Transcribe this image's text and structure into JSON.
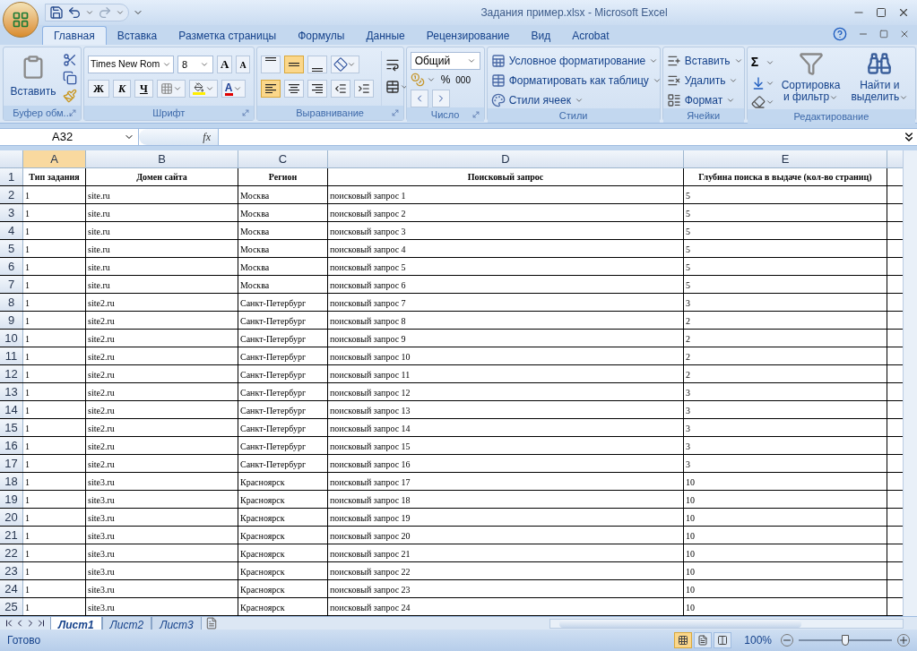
{
  "title_bar": {
    "title": "Задания пример.xlsx - Microsoft Excel"
  },
  "tabs": [
    {
      "label": "Главная",
      "selected": true
    },
    {
      "label": "Вставка",
      "selected": false
    },
    {
      "label": "Разметка страницы",
      "selected": false
    },
    {
      "label": "Формулы",
      "selected": false
    },
    {
      "label": "Данные",
      "selected": false
    },
    {
      "label": "Рецензирование",
      "selected": false
    },
    {
      "label": "Вид",
      "selected": false
    },
    {
      "label": "Acrobat",
      "selected": false
    }
  ],
  "ribbon": {
    "clipboard": {
      "label": "Буфер обм...",
      "paste": "Вставить"
    },
    "font": {
      "label": "Шрифт",
      "font_name": "Times New Rom",
      "font_size": "8",
      "grow": "A",
      "shrink": "A",
      "bold": "Ж",
      "italic": "К",
      "underline": "Ч",
      "font_color": "A"
    },
    "alignment": {
      "label": "Выравнивание",
      "vertical": [
        {
          "selected": false
        },
        {
          "selected": true
        },
        {
          "selected": false
        }
      ],
      "horizontal": [
        {
          "selected": true
        },
        {
          "selected": false
        },
        {
          "selected": false
        }
      ]
    },
    "number": {
      "label": "Число",
      "format": "Общий",
      "percent": "%",
      "thousands": "000"
    },
    "styles": {
      "label": "Стили",
      "items": [
        "Условное форматирование",
        "Форматировать как таблицу",
        "Стили ячеек"
      ]
    },
    "cells": {
      "label": "Ячейки",
      "items": [
        "Вставить",
        "Удалить",
        "Формат"
      ]
    },
    "editing": {
      "label": "Редактирование",
      "sigma": "Σ",
      "sort": [
        "Сортировка",
        "и фильтр"
      ],
      "find": [
        "Найти и",
        "выделить"
      ]
    }
  },
  "formula_bar": {
    "name_box": "A32",
    "fx": "fx"
  },
  "sheet": {
    "columns": [
      {
        "label": "A",
        "selected": true
      },
      {
        "label": "B",
        "selected": false
      },
      {
        "label": "C",
        "selected": false
      },
      {
        "label": "D",
        "selected": false
      },
      {
        "label": "E",
        "selected": false
      }
    ],
    "rows": [
      {
        "number": "1",
        "kind": "header",
        "cells": [
          "Тип задания",
          "Домен сайта",
          "Регион",
          "Поисковый запрос",
          "Глубина поиска в выдаче (кол-во страниц)"
        ]
      },
      {
        "number": "2",
        "kind": "data",
        "cells": [
          "1",
          "site.ru",
          "Москва",
          "поисковый запрос 1",
          "5"
        ]
      },
      {
        "number": "3",
        "kind": "data",
        "cells": [
          "1",
          "site.ru",
          "Москва",
          "поисковый запрос 2",
          "5"
        ]
      },
      {
        "number": "4",
        "kind": "data",
        "cells": [
          "1",
          "site.ru",
          "Москва",
          "поисковый запрос 3",
          "5"
        ]
      },
      {
        "number": "5",
        "kind": "data",
        "cells": [
          "1",
          "site.ru",
          "Москва",
          "поисковый запрос 4",
          "5"
        ]
      },
      {
        "number": "6",
        "kind": "data",
        "cells": [
          "1",
          "site.ru",
          "Москва",
          "поисковый запрос 5",
          "5"
        ]
      },
      {
        "number": "7",
        "kind": "data",
        "cells": [
          "1",
          "site.ru",
          "Москва",
          "поисковый запрос 6",
          "5"
        ]
      },
      {
        "number": "8",
        "kind": "data",
        "cells": [
          "1",
          "site2.ru",
          "Санкт-Петербург",
          "поисковый запрос 7",
          "3"
        ]
      },
      {
        "number": "9",
        "kind": "data",
        "cells": [
          "1",
          "site2.ru",
          "Санкт-Петербург",
          "поисковый запрос 8",
          "2"
        ]
      },
      {
        "number": "10",
        "kind": "data",
        "cells": [
          "1",
          "site2.ru",
          "Санкт-Петербург",
          "поисковый запрос 9",
          "2"
        ]
      },
      {
        "number": "11",
        "kind": "data",
        "cells": [
          "1",
          "site2.ru",
          "Санкт-Петербург",
          "поисковый запрос 10",
          "2"
        ]
      },
      {
        "number": "12",
        "kind": "data",
        "cells": [
          "1",
          "site2.ru",
          "Санкт-Петербург",
          "поисковый запрос 11",
          "2"
        ]
      },
      {
        "number": "13",
        "kind": "data",
        "cells": [
          "1",
          "site2.ru",
          "Санкт-Петербург",
          "поисковый запрос 12",
          "3"
        ]
      },
      {
        "number": "14",
        "kind": "data",
        "cells": [
          "1",
          "site2.ru",
          "Санкт-Петербург",
          "поисковый запрос 13",
          "3"
        ]
      },
      {
        "number": "15",
        "kind": "data",
        "cells": [
          "1",
          "site2.ru",
          "Санкт-Петербург",
          "поисковый запрос 14",
          "3"
        ]
      },
      {
        "number": "16",
        "kind": "data",
        "cells": [
          "1",
          "site2.ru",
          "Санкт-Петербург",
          "поисковый запрос 15",
          "3"
        ]
      },
      {
        "number": "17",
        "kind": "data",
        "cells": [
          "1",
          "site2.ru",
          "Санкт-Петербург",
          "поисковый запрос 16",
          "3"
        ]
      },
      {
        "number": "18",
        "kind": "data",
        "cells": [
          "1",
          "site3.ru",
          "Красноярск",
          "поисковый запрос 17",
          "10"
        ]
      },
      {
        "number": "19",
        "kind": "data",
        "cells": [
          "1",
          "site3.ru",
          "Красноярск",
          "поисковый запрос 18",
          "10"
        ]
      },
      {
        "number": "20",
        "kind": "data",
        "cells": [
          "1",
          "site3.ru",
          "Красноярск",
          "поисковый запрос 19",
          "10"
        ]
      },
      {
        "number": "21",
        "kind": "data",
        "cells": [
          "1",
          "site3.ru",
          "Красноярск",
          "поисковый запрос 20",
          "10"
        ]
      },
      {
        "number": "22",
        "kind": "data",
        "cells": [
          "1",
          "site3.ru",
          "Красноярск",
          "поисковый запрос 21",
          "10"
        ]
      },
      {
        "number": "23",
        "kind": "data",
        "cells": [
          "1",
          "site3.ru",
          "Красноярск",
          "поисковый запрос 22",
          "10"
        ]
      },
      {
        "number": "24",
        "kind": "data",
        "cells": [
          "1",
          "site3.ru",
          "Красноярск",
          "поисковый запрос 23",
          "10"
        ]
      },
      {
        "number": "25",
        "kind": "data",
        "cells": [
          "1",
          "site3.ru",
          "Красноярск",
          "поисковый запрос 24",
          "10"
        ]
      }
    ]
  },
  "sheet_tabs": [
    {
      "label": "Лист1",
      "selected": true
    },
    {
      "label": "Лист2",
      "selected": false
    },
    {
      "label": "Лист3",
      "selected": false
    }
  ],
  "status_bar": {
    "status": "Готово",
    "views": [
      {
        "selected": true
      },
      {
        "selected": false
      },
      {
        "selected": false
      }
    ],
    "zoom": "100%",
    "zoom_slider": {
      "level": 0.5
    }
  }
}
